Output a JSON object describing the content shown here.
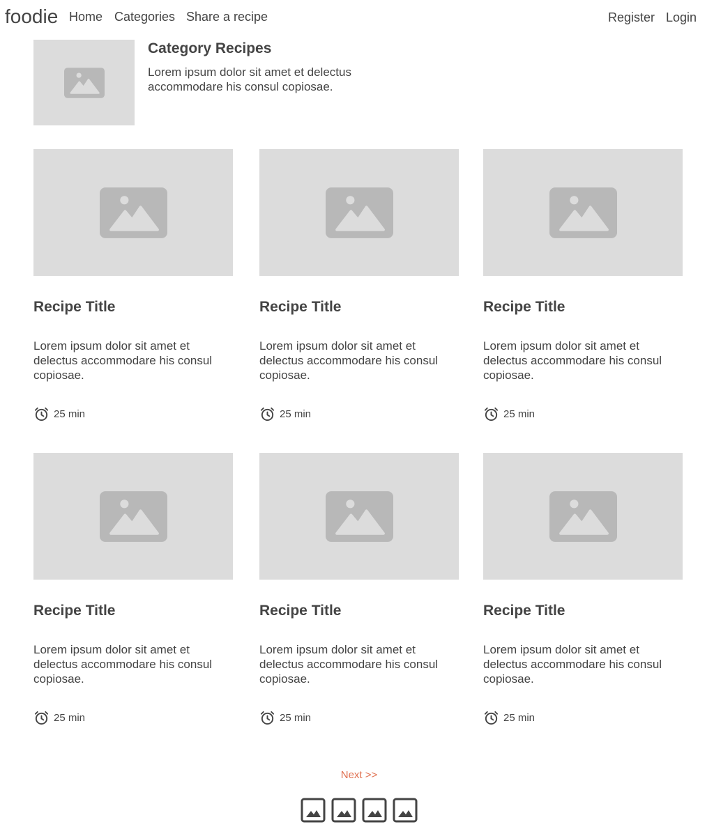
{
  "nav": {
    "brand": "foodie",
    "links": [
      "Home",
      "Categories",
      "Share a recipe"
    ],
    "register": "Register",
    "login": "Login"
  },
  "category": {
    "image_icon": "image-placeholder-icon",
    "title": "Category Recipes",
    "description": "Lorem ipsum dolor sit amet et delectus accommodare his consul copiosae."
  },
  "recipes": [
    {
      "image_icon": "image-placeholder-icon",
      "title": "Recipe Title",
      "description": "Lorem ipsum dolor sit amet et delectus accommodare his consul copiosae.",
      "time_icon": "alarm-clock-icon",
      "time": "25 min"
    },
    {
      "image_icon": "image-placeholder-icon",
      "title": "Recipe Title",
      "description": "Lorem ipsum dolor sit amet et delectus accommodare his consul copiosae.",
      "time_icon": "alarm-clock-icon",
      "time": "25 min"
    },
    {
      "image_icon": "image-placeholder-icon",
      "title": "Recipe Title",
      "description": "Lorem ipsum dolor sit amet et delectus accommodare his consul copiosae.",
      "time_icon": "alarm-clock-icon",
      "time": "25 min"
    },
    {
      "image_icon": "image-placeholder-icon",
      "title": "Recipe Title",
      "description": "Lorem ipsum dolor sit amet et delectus accommodare his consul copiosae.",
      "time_icon": "alarm-clock-icon",
      "time": "25 min"
    },
    {
      "image_icon": "image-placeholder-icon",
      "title": "Recipe Title",
      "description": "Lorem ipsum dolor sit amet et delectus accommodare his consul copiosae.",
      "time_icon": "alarm-clock-icon",
      "time": "25 min"
    },
    {
      "image_icon": "image-placeholder-icon",
      "title": "Recipe Title",
      "description": "Lorem ipsum dolor sit amet et delectus accommodare his consul copiosae.",
      "time_icon": "alarm-clock-icon",
      "time": "25 min"
    }
  ],
  "pagination": {
    "next_label": "Next >>",
    "page_icons": [
      "image-icon",
      "image-icon",
      "image-icon",
      "image-icon"
    ]
  },
  "colors": {
    "placeholder_bg": "#dcdcdc",
    "placeholder_icon": "#b8b8b8",
    "text": "#444444",
    "accent": "#e07050"
  }
}
